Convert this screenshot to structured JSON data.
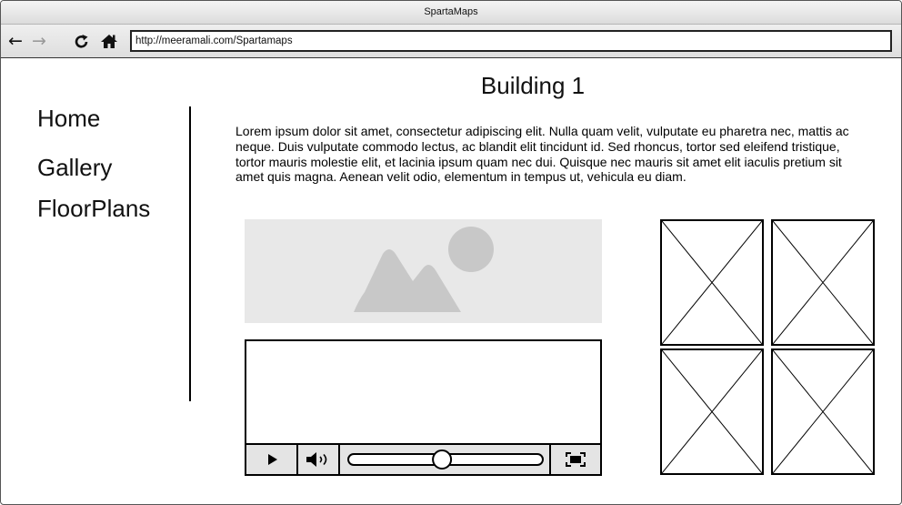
{
  "window": {
    "title": "SpartaMaps"
  },
  "toolbar": {
    "back_icon": "arrow-left-icon",
    "forward_icon": "arrow-right-icon",
    "reload_icon": "reload-icon",
    "home_icon": "home-icon",
    "url": "http://meeramali.com/Spartamaps"
  },
  "page": {
    "title": "Building 1",
    "body": "Lorem ipsum dolor sit amet, consectetur adipiscing elit. Nulla quam velit, vulputate eu pharetra nec, mattis ac neque. Duis vulputate commodo lectus, ac blandit elit tincidunt id. Sed rhoncus, tortor sed eleifend tristique, tortor mauris molestie elit, et lacinia ipsum quam nec dui. Quisque nec mauris sit amet elit iaculis pretium sit amet quis magna. Aenean velit odio, elementum in tempus ut, vehicula eu diam."
  },
  "sidebar": {
    "items": [
      {
        "label": "Home"
      },
      {
        "label": "Gallery"
      },
      {
        "label": "FloorPlans"
      }
    ]
  },
  "video": {
    "play_icon": "play-icon",
    "volume_icon": "volume-icon",
    "fullscreen_icon": "fullscreen-icon",
    "progress": 0.48
  },
  "colors": {
    "placeholder_bg": "#e8e8e8",
    "placeholder_shape": "#c8c8c8",
    "controls_bg": "#e4e4e4"
  }
}
